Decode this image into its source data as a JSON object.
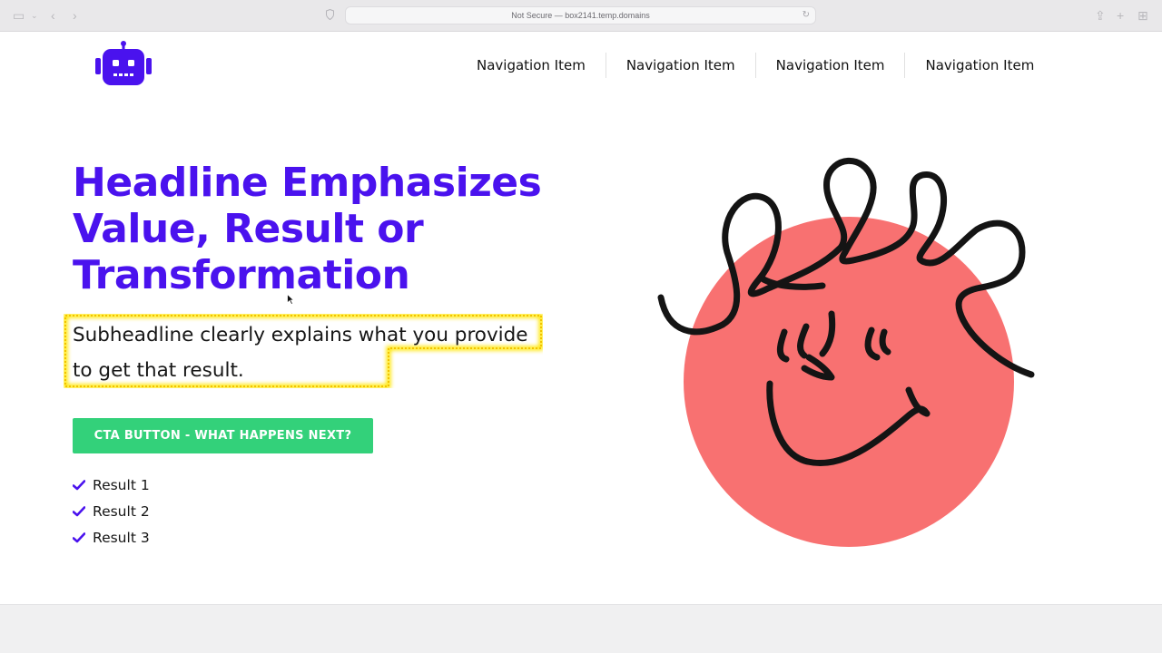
{
  "browser": {
    "url_text": "Not Secure — box2141.temp.domains"
  },
  "header": {
    "logo_icon": "robot-icon",
    "nav": [
      {
        "label": "Navigation Item"
      },
      {
        "label": "Navigation Item"
      },
      {
        "label": "Navigation Item"
      },
      {
        "label": "Navigation Item"
      }
    ]
  },
  "hero": {
    "headline": "Headline Emphasizes Value, Result or Transformation",
    "subheadline": "Subheadline clearly explains what you provide to get that result.",
    "cta_label": "CTA BUTTON - WHAT HAPPENS NEXT?",
    "results": [
      {
        "label": "Result 1"
      },
      {
        "label": "Result 2"
      },
      {
        "label": "Result 3"
      }
    ]
  },
  "colors": {
    "brand": "#4a12ee",
    "cta": "#33d17a",
    "illustration_circle": "#f87171",
    "highlight": "#ffe600"
  }
}
